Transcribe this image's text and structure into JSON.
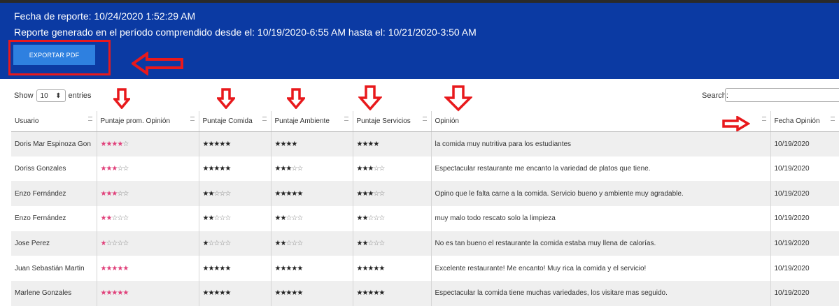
{
  "report": {
    "date_line": "Fecha de reporte: 10/24/2020 1:52:29 AM",
    "period_line": "Reporte generado en el período comprendido desde el: 10/19/2020-6:55 AM hasta el: 10/21/2020-3:50 AM",
    "export_label": "EXPORTAR PDF"
  },
  "colors": {
    "banner": "#0b3aa3",
    "button": "#2e80e0",
    "annotation": "#e8191c",
    "pink_star": "#e0407a"
  },
  "controls": {
    "show": "Show",
    "entries_value": "10",
    "entries": "entries",
    "search": "Search:"
  },
  "table": {
    "columns": [
      "Usuario",
      "Puntaje prom. Opinión",
      "Puntaje Comida",
      "Puntaje Ambiente",
      "Puntaje Servicios",
      "Opinión",
      "Fecha Opinión"
    ],
    "rows": [
      {
        "user": "Doris Mar Espinoza Gon",
        "avg": 4,
        "food": 5,
        "ambient": 4,
        "ambient_max": 4,
        "service": 4,
        "service_max": 4,
        "opinion": "la comida muy nutritiva para los estudiantes",
        "date": "10/19/2020"
      },
      {
        "user": "Doriss Gonzales",
        "avg": 3,
        "food": 5,
        "ambient": 3,
        "ambient_max": 5,
        "service": 3,
        "service_max": 5,
        "opinion": "Espectacular restaurante me encanto la variedad de platos que tiene.",
        "date": "10/19/2020"
      },
      {
        "user": "Enzo Fernández",
        "avg": 3,
        "food": 2,
        "ambient": 5,
        "ambient_max": 5,
        "service": 3,
        "service_max": 5,
        "opinion": "Opino que le falta carne a la comida. Servicio bueno y ambiente muy agradable.",
        "date": "10/19/2020"
      },
      {
        "user": "Enzo Fernández",
        "avg": 2,
        "food": 2,
        "ambient": 2,
        "ambient_max": 5,
        "service": 2,
        "service_max": 5,
        "opinion": "muy malo todo rescato solo la limpieza",
        "date": "10/19/2020"
      },
      {
        "user": "Jose Perez",
        "avg": 1,
        "food": 1,
        "ambient": 2,
        "ambient_max": 5,
        "service": 2,
        "service_max": 5,
        "opinion": "No es tan bueno el restaurante la comida estaba muy llena de calorías.",
        "date": "10/19/2020"
      },
      {
        "user": "Juan Sebastián Martin",
        "avg": 5,
        "food": 5,
        "ambient": 5,
        "ambient_max": 5,
        "service": 5,
        "service_max": 5,
        "opinion": "Excelente restaurante! Me encanto! Muy rica la comida y el servicio!",
        "date": "10/19/2020"
      },
      {
        "user": "Marlene Gonzales",
        "avg": 5,
        "food": 5,
        "ambient": 5,
        "ambient_max": 5,
        "service": 5,
        "service_max": 5,
        "opinion": "Espectacular la comida tiene muchas variedades, los visitare mas seguido.",
        "date": "10/19/2020"
      }
    ]
  }
}
